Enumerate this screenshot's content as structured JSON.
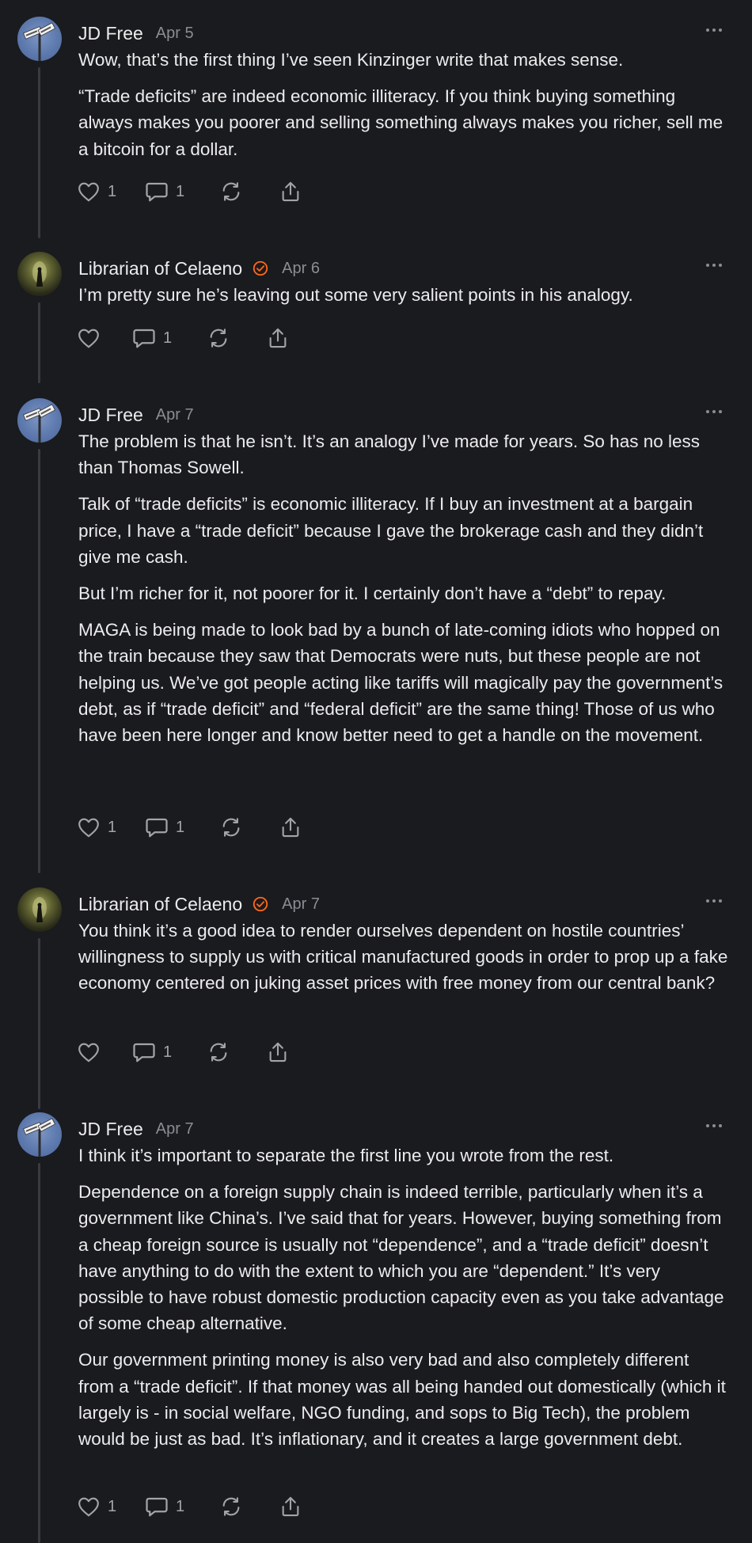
{
  "comments": [
    {
      "author": "JD Free",
      "date": "Apr 5",
      "avatar": "road-sign-avatar",
      "verified": false,
      "paragraphs": [
        "Wow, that’s the first thing I’ve seen Kinzinger write that makes sense.",
        "“Trade deficits” are indeed economic illiteracy. If you think buying something always makes you poorer and selling something always makes you richer, sell me a bitcoin for a dollar."
      ],
      "likes": "1",
      "replies": "1"
    },
    {
      "author": "Librarian of Celaeno",
      "date": "Apr 6",
      "avatar": "glowing-doorway-avatar",
      "verified": true,
      "paragraphs": [
        "I’m pretty sure he’s leaving out some very salient points in his analogy."
      ],
      "likes": "",
      "replies": "1"
    },
    {
      "author": "JD Free",
      "date": "Apr 7",
      "avatar": "road-sign-avatar",
      "verified": false,
      "paragraphs": [
        "The problem is that he isn’t. It’s an analogy I’ve made for years. So has no less than Thomas Sowell.",
        "Talk of “trade deficits” is economic illiteracy. If I buy an investment at a bargain price, I have a “trade deficit” because I gave the brokerage cash and they didn’t give me cash.",
        "But I’m richer for it, not poorer for it. I certainly don’t have a “debt” to repay.",
        "MAGA is being made to look bad by a bunch of late-coming idiots who hopped on the train because they saw that Democrats were nuts, but these people are not helping us. We’ve got people acting like tariffs will magically pay the government’s debt, as if “trade deficit” and “federal deficit” are the same thing! Those of us who have been here longer and know better need to get a handle on the movement."
      ],
      "likes": "1",
      "replies": "1"
    },
    {
      "author": "Librarian of Celaeno",
      "date": "Apr 7",
      "avatar": "glowing-doorway-avatar",
      "verified": true,
      "paragraphs": [
        "You think it’s a good idea to render ourselves dependent on hostile countries’ willingness to supply us with critical manufactured goods in order to prop up a fake economy centered on juking asset prices with free money from our central bank?"
      ],
      "likes": "",
      "replies": "1"
    },
    {
      "author": "JD Free",
      "date": "Apr 7",
      "avatar": "road-sign-avatar",
      "verified": false,
      "paragraphs": [
        "I think it’s important to separate the first line you wrote from the rest.",
        "Dependence on a foreign supply chain is indeed terrible, particularly when it’s a government like China’s. I’ve said that for years. However, buying something from a cheap foreign source is usually not “dependence”, and a “trade deficit” doesn’t have anything to do with the extent to which you are “dependent.” It’s very possible to have robust domestic production capacity even as you take advantage of some cheap alternative.",
        "Our government printing money is also very bad and also completely different from a “trade deficit”. If that money was all being handed out domestically (which it largely is - in social welfare, NGO funding, and sops to Big Tech), the problem would be just as bad. It’s inflationary, and it creates a large government debt."
      ],
      "likes": "1",
      "replies": "1"
    }
  ],
  "colors": {
    "background": "#1a1b1e",
    "text": "#ececee",
    "muted": "#8b8d93",
    "icon": "#a2a4a9",
    "verified_accent": "#ff6719",
    "thread_line": "#3a3b3f"
  }
}
